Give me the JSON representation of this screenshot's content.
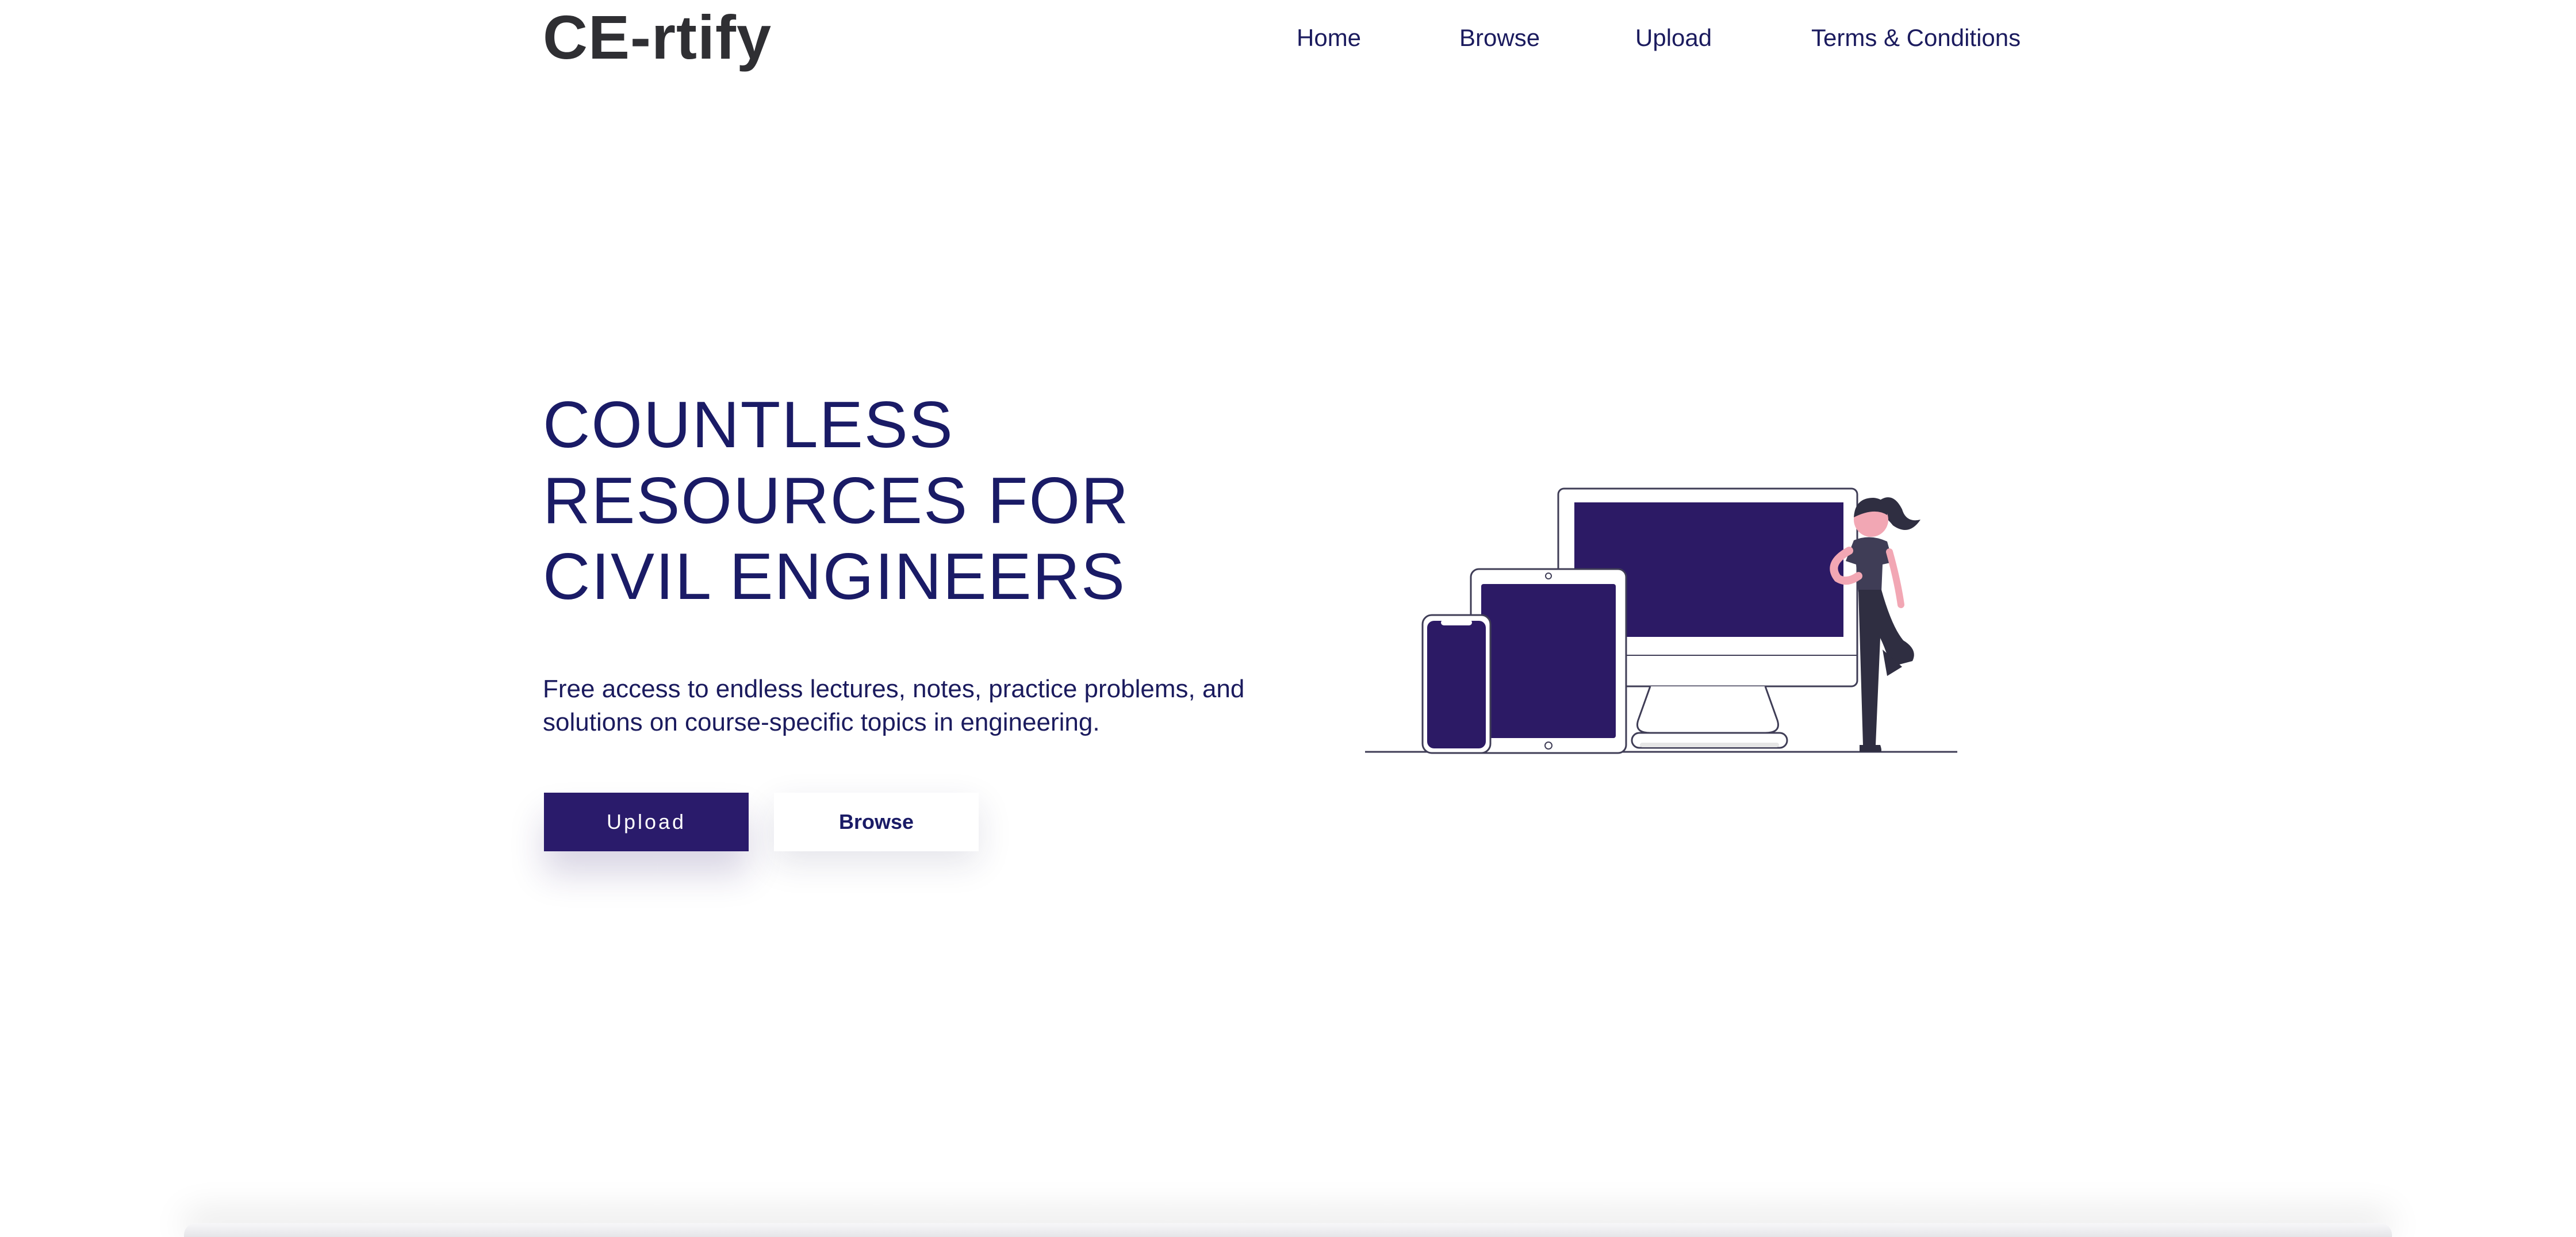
{
  "brand": {
    "logo_text": "CE-rtify"
  },
  "nav": {
    "items": [
      {
        "label": "Home"
      },
      {
        "label": "Browse"
      },
      {
        "label": "Upload"
      },
      {
        "label": "Terms & Conditions"
      }
    ]
  },
  "hero": {
    "headline": "COUNTLESS RESOURCES FOR CIVIL ENGINEERS",
    "subtext": "Free access to endless lectures, notes, practice problems, and solutions on course-specific topics in engineering.",
    "primary_button_label": "Upload",
    "secondary_button_label": "Browse",
    "illustration": "devices-woman-illustration"
  },
  "colors": {
    "primary": "#2a1b6b",
    "heading": "#1a1b66",
    "nav_text": "#1b1b5e",
    "logo": "#2f2f33",
    "screen": "#2c1a65",
    "skin": "#f2a7b4",
    "hair_and_clothes": "#2f2e41",
    "shirt": "#3f3d56"
  }
}
